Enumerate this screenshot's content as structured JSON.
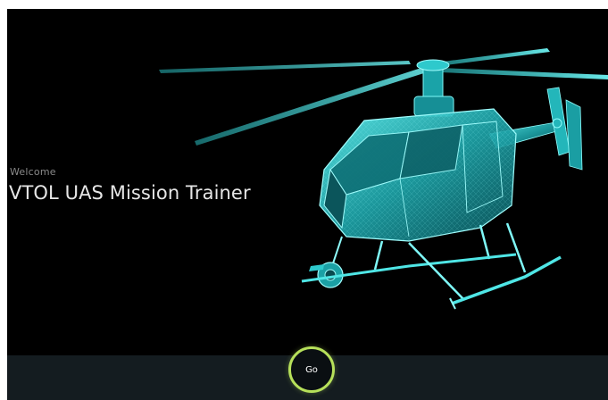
{
  "welcome": {
    "greeting": "Welcome",
    "app_title": "VTOL UAS Mission Trainer"
  },
  "actions": {
    "go_label": "Go"
  },
  "colors": {
    "background": "#000000",
    "wireframe": "#3fd8d8",
    "go_ring": "#b6e05a",
    "bottom_bar": "#141c20"
  },
  "icons": {
    "hero": "helicopter-wireframe-illustration"
  }
}
